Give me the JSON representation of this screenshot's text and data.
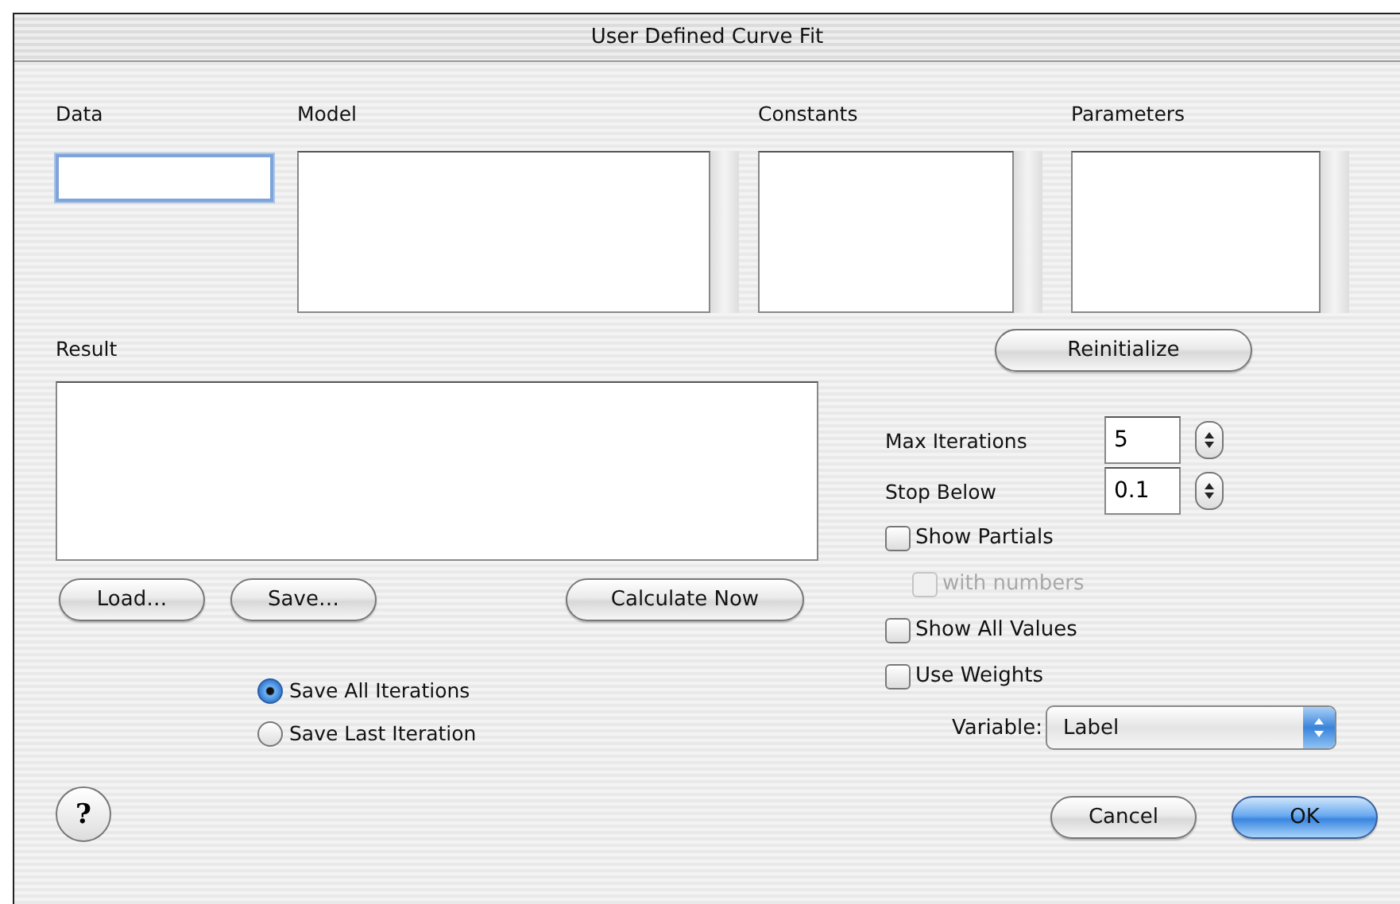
{
  "window": {
    "title": "User Defined Curve Fit"
  },
  "data": {
    "label": "Data",
    "focused": true
  },
  "lists": [
    {
      "label": "Model",
      "kind": "wide"
    },
    {
      "label": "Constants",
      "kind": "narrow"
    },
    {
      "label": "Parameters",
      "kind": "narrow"
    }
  ],
  "reinitialize_button": "Reinitialize",
  "result": {
    "label": "Result"
  },
  "file_buttons": [
    "Load…",
    "Save…"
  ],
  "calculate_button": "Calculate Now",
  "save_options": [
    {
      "label": "Save All Iterations",
      "selected": true
    },
    {
      "label": "Save Last Iteration",
      "selected": false
    }
  ],
  "settings": [
    {
      "label": "Max Iterations",
      "value": "5"
    },
    {
      "label": "Stop Below",
      "value": "0.1"
    }
  ],
  "options": [
    {
      "label": "Show Partials",
      "checked": false,
      "disabled": false,
      "children": [
        {
          "label": "with numbers",
          "checked": false,
          "disabled": true
        }
      ]
    },
    {
      "label": "Show All Values",
      "checked": false,
      "disabled": false
    },
    {
      "label": "Use Weights",
      "checked": false,
      "disabled": false
    }
  ],
  "variable": {
    "label": "Variable:",
    "value": "Label"
  },
  "help_button": "?",
  "buttons": [
    {
      "label": "Cancel",
      "default": false
    },
    {
      "label": "OK",
      "default": true
    }
  ]
}
